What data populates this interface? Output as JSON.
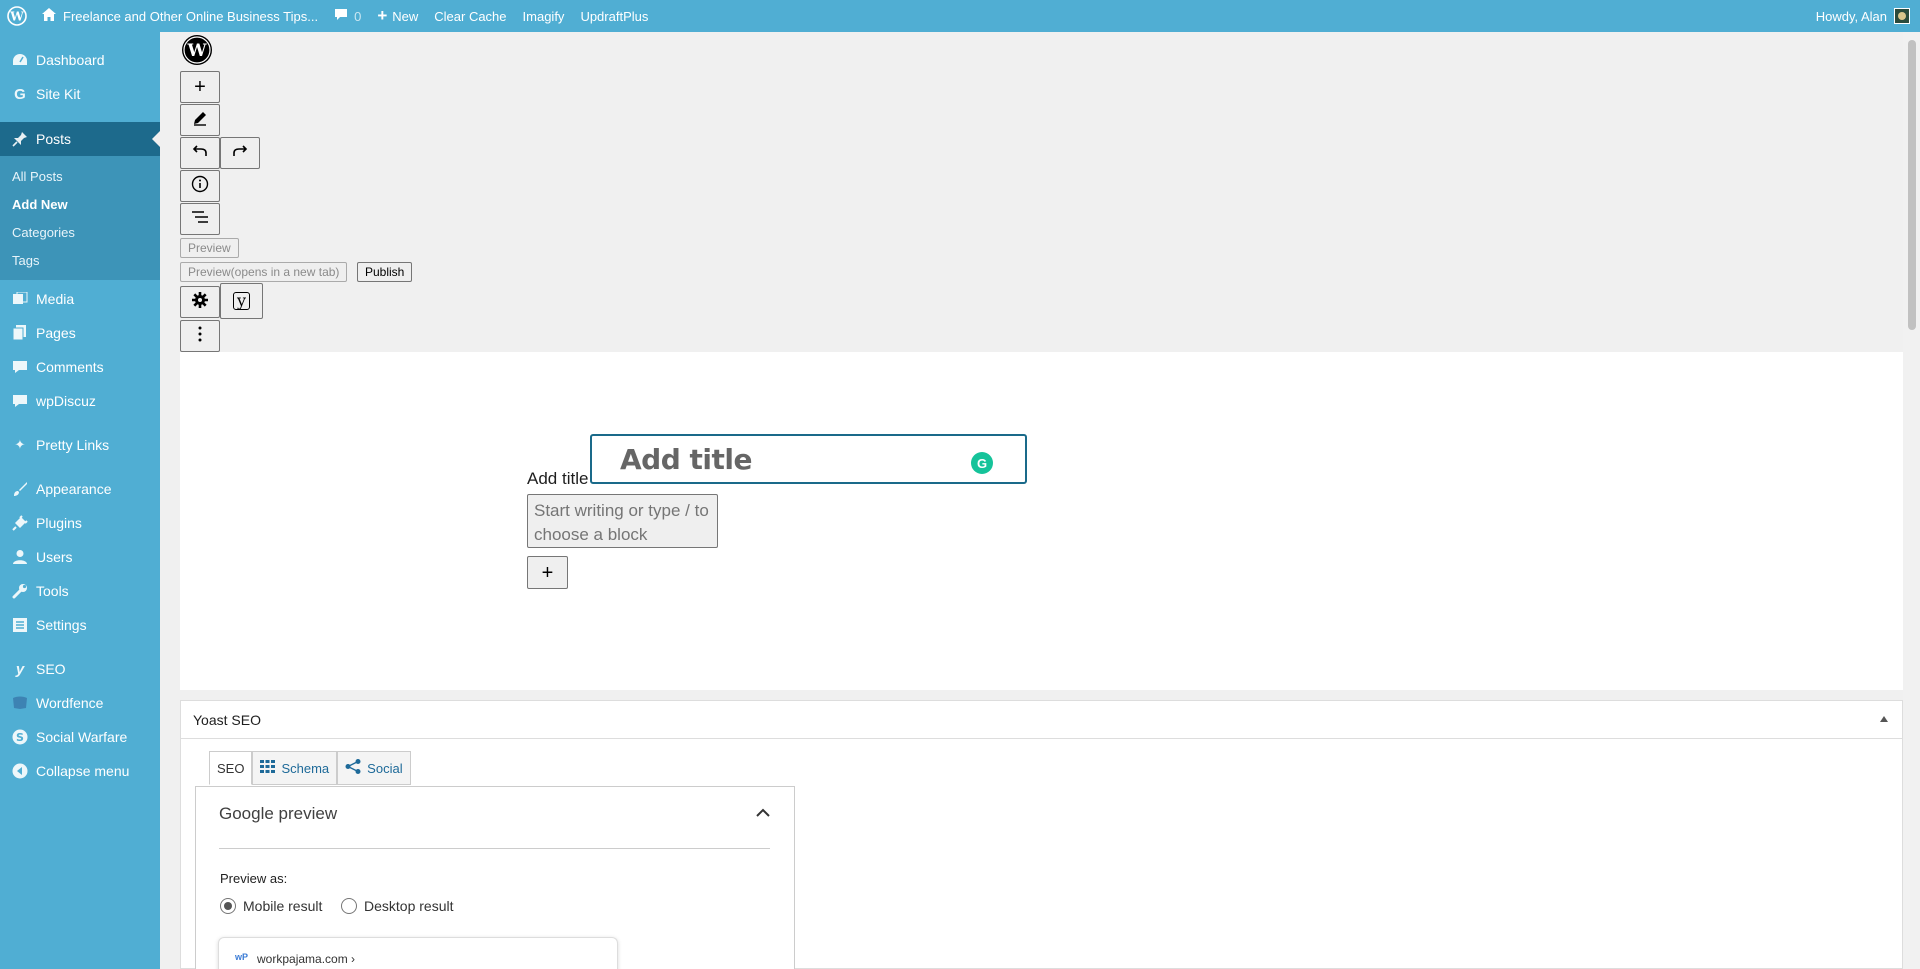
{
  "adminbar": {
    "site_name": "Freelance and Other Online Business Tips...",
    "comments_count": "0",
    "new_label": "New",
    "clear_cache": "Clear Cache",
    "imagify": "Imagify",
    "updraft": "UpdraftPlus",
    "howdy": "Howdy, Alan"
  },
  "sidebar": {
    "items_top": [
      {
        "label": "Dashboard",
        "icon": "dashboard-icon"
      },
      {
        "label": "Site Kit",
        "icon": "google-g-icon"
      }
    ],
    "posts": {
      "label": "Posts",
      "icon": "pin-icon"
    },
    "posts_sub": [
      "All Posts",
      "Add New",
      "Categories",
      "Tags"
    ],
    "items_mid": [
      {
        "label": "Media",
        "icon": "media-icon"
      },
      {
        "label": "Pages",
        "icon": "pages-icon"
      },
      {
        "label": "Comments",
        "icon": "comment-icon"
      },
      {
        "label": "wpDiscuz",
        "icon": "comment-icon"
      }
    ],
    "pretty_links": {
      "label": "Pretty Links",
      "icon": "star-icon"
    },
    "items_admin": [
      {
        "label": "Appearance",
        "icon": "brush-icon"
      },
      {
        "label": "Plugins",
        "icon": "plug-icon"
      },
      {
        "label": "Users",
        "icon": "user-icon"
      },
      {
        "label": "Tools",
        "icon": "wrench-icon"
      },
      {
        "label": "Settings",
        "icon": "settings-icon"
      }
    ],
    "items_plugins": [
      {
        "label": "SEO",
        "icon": "yoast-icon"
      },
      {
        "label": "Wordfence",
        "icon": "shield-icon"
      },
      {
        "label": "Social Warfare",
        "icon": "s-icon"
      },
      {
        "label": "Collapse menu",
        "icon": "collapse-icon"
      }
    ]
  },
  "editor": {
    "preview_label": "Preview",
    "preview_newtab_label": "Preview(opens in a new tab)",
    "publish_label": "Publish",
    "title_placeholder": "Add title",
    "title_label": "Add title",
    "block_placeholder": "Start writing or type / to choose a block"
  },
  "yoast": {
    "header": "Yoast SEO",
    "tabs": [
      {
        "label": "SEO",
        "icon": ""
      },
      {
        "label": "Schema",
        "icon": "grid-icon"
      },
      {
        "label": "Social",
        "icon": "share-icon"
      }
    ],
    "google_preview_title": "Google preview",
    "preview_as_label": "Preview as:",
    "radio_mobile": "Mobile result",
    "radio_desktop": "Desktop result",
    "serp_url": "workpajama.com ›",
    "serp_favicon": "wP"
  },
  "colors": {
    "admin_blue": "#50aed3",
    "admin_blue_dark": "#1d6a8c",
    "grammarly_green": "#15c39a"
  }
}
